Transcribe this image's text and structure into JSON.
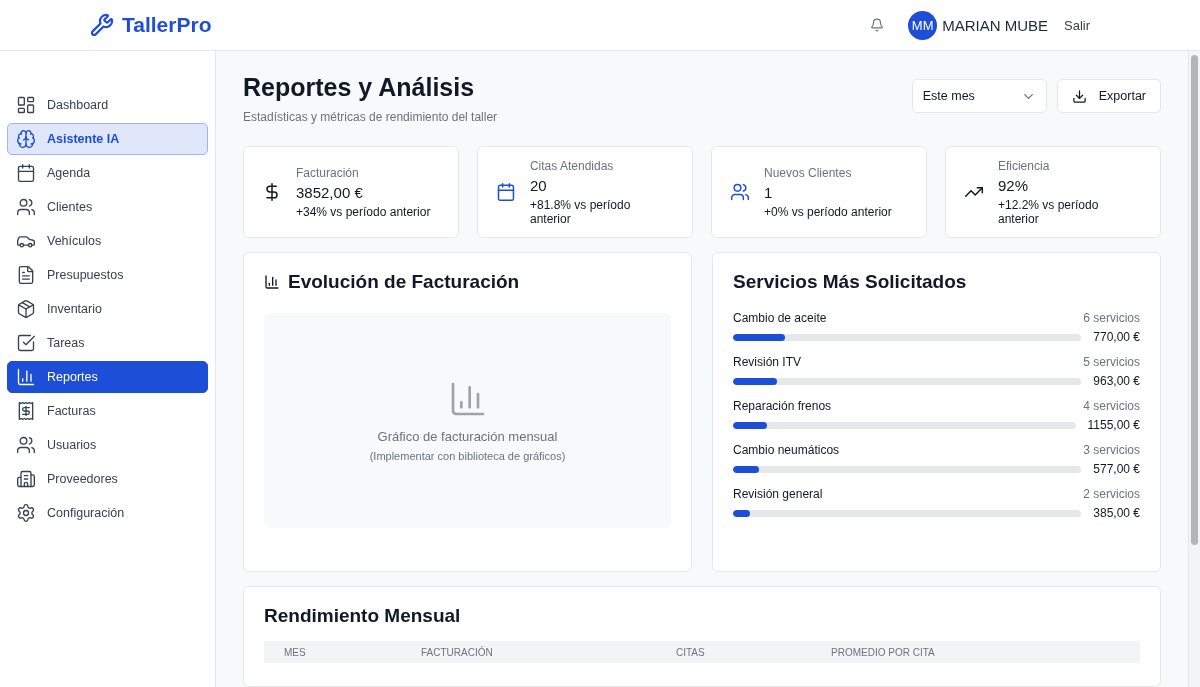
{
  "header": {
    "brand": "TallerPro",
    "user": {
      "initials": "MM",
      "name": "MARIAN MUBE"
    },
    "logout": "Salir"
  },
  "sidebar": {
    "items": [
      {
        "label": "Dashboard",
        "selected": false,
        "highlighted": false
      },
      {
        "label": "Asistente IA",
        "selected": false,
        "highlighted": true
      },
      {
        "label": "Agenda",
        "selected": false,
        "highlighted": false
      },
      {
        "label": "Clientes",
        "selected": false,
        "highlighted": false
      },
      {
        "label": "Vehículos",
        "selected": false,
        "highlighted": false
      },
      {
        "label": "Presupuestos",
        "selected": false,
        "highlighted": false
      },
      {
        "label": "Inventario",
        "selected": false,
        "highlighted": false
      },
      {
        "label": "Tareas",
        "selected": false,
        "highlighted": false
      },
      {
        "label": "Reportes",
        "selected": true,
        "highlighted": false
      },
      {
        "label": "Facturas",
        "selected": false,
        "highlighted": false
      },
      {
        "label": "Usuarios",
        "selected": false,
        "highlighted": false
      },
      {
        "label": "Proveedores",
        "selected": false,
        "highlighted": false
      },
      {
        "label": "Configuración",
        "selected": false,
        "highlighted": false
      }
    ]
  },
  "page": {
    "title": "Reportes y Análisis",
    "subtitle": "Estadísticas y métricas de rendimiento del taller",
    "period_select": {
      "value": "Este mes"
    },
    "export_button": "Exportar"
  },
  "stats": [
    {
      "label": "Facturación",
      "value": "3852,00 €",
      "change": "+34% vs período anterior"
    },
    {
      "label": "Citas Atendidas",
      "value": "20",
      "change": "+81.8% vs período anterior"
    },
    {
      "label": "Nuevos Clientes",
      "value": "1",
      "change": "+0% vs período anterior"
    },
    {
      "label": "Eficiencia",
      "value": "92%",
      "change": "+12.2% vs período anterior"
    }
  ],
  "billing_panel": {
    "title": "Evolución de Facturación",
    "placeholder_text": "Gráfico de facturación mensual",
    "placeholder_note": "(Implementar con biblioteca de gráficos)"
  },
  "services": {
    "title": "Servicios Más Solicitados",
    "items": [
      {
        "name": "Cambio de aceite",
        "count": "6 servicios",
        "amount": "770,00 €",
        "level": 0.15
      },
      {
        "name": "Revisión ITV",
        "count": "5 servicios",
        "amount": "963,00 €",
        "level": 0.125
      },
      {
        "name": "Reparación frenos",
        "count": "4 servicios",
        "amount": "1155,00 €",
        "level": 0.1
      },
      {
        "name": "Cambio neumáticos",
        "count": "3 servicios",
        "amount": "577,00 €",
        "level": 0.075
      },
      {
        "name": "Revisión general",
        "count": "2 servicios",
        "amount": "385,00 €",
        "level": 0.05
      }
    ]
  },
  "monthly": {
    "title": "Rendimiento Mensual",
    "columns": [
      "MES",
      "FACTURACIÓN",
      "CITAS",
      "PROMEDIO POR CITA"
    ]
  }
}
